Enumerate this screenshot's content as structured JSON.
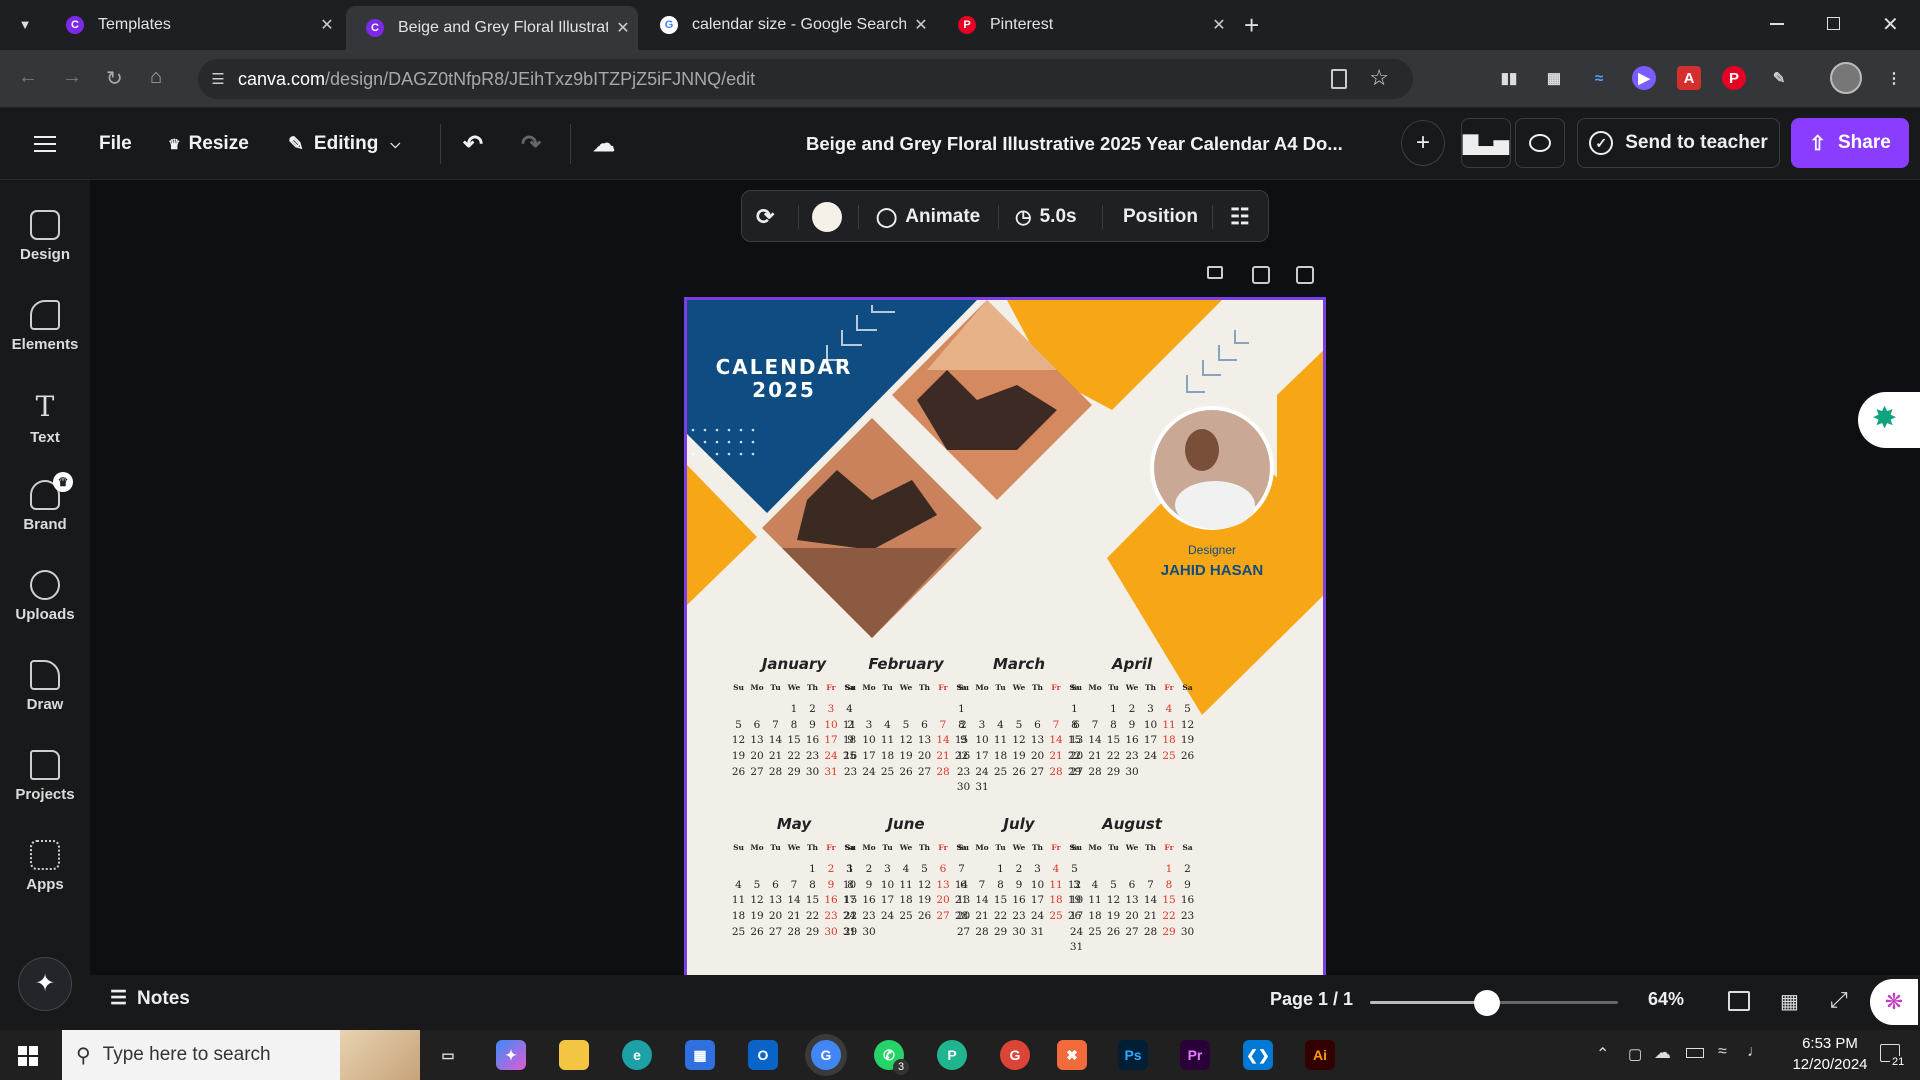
{
  "browser": {
    "tabs": [
      {
        "title": "Templates",
        "icon": "canva-icon",
        "active": false
      },
      {
        "title": "Beige and Grey Floral Illustrativ",
        "icon": "canva-icon",
        "active": true
      },
      {
        "title": "calendar size - Google Search",
        "icon": "google-icon",
        "active": false
      },
      {
        "title": "Pinterest",
        "icon": "pinterest-icon",
        "active": false
      }
    ],
    "new_tab": "+",
    "url_host": "canva.com",
    "url_path": "/design/DAGZ0tNfpR8/JEihTxz9bITZPjZ5iFJNNQ/edit"
  },
  "header": {
    "menu_icon": "hamburger-icon",
    "file": "File",
    "resize": "Resize",
    "editing": "Editing",
    "doc_title": "Beige and Grey Floral Illustrative 2025 Year Calendar A4 Do...",
    "send": "Send to teacher",
    "share": "Share",
    "add": "+"
  },
  "sidebar": {
    "items": [
      {
        "label": "Design",
        "icon": "design-icon"
      },
      {
        "label": "Elements",
        "icon": "elements-icon"
      },
      {
        "label": "Text",
        "icon": "text-icon"
      },
      {
        "label": "Brand",
        "icon": "brand-icon"
      },
      {
        "label": "Uploads",
        "icon": "uploads-icon"
      },
      {
        "label": "Draw",
        "icon": "draw-icon"
      },
      {
        "label": "Projects",
        "icon": "projects-icon"
      },
      {
        "label": "Apps",
        "icon": "apps-icon"
      }
    ],
    "text_glyph": "T"
  },
  "context_toolbar": {
    "animate": "Animate",
    "duration": "5.0s",
    "position": "Position"
  },
  "design": {
    "title_line1": "CALENDAR",
    "title_line2": "2025",
    "designer_label": "Designer",
    "designer_name": "JAHID HASAN",
    "weekday_header": [
      "Su",
      "Mo",
      "Tu",
      "We",
      "Th",
      "Fr",
      "Sa"
    ],
    "months": [
      {
        "name": "January",
        "rows": [
          [
            "",
            "",
            "",
            "1",
            "2",
            "3",
            "4"
          ],
          [
            "5",
            "6",
            "7",
            "8",
            "9",
            "10",
            "11"
          ],
          [
            "12",
            "13",
            "14",
            "15",
            "16",
            "17",
            "18"
          ],
          [
            "19",
            "20",
            "21",
            "22",
            "23",
            "24",
            "25"
          ],
          [
            "26",
            "27",
            "28",
            "29",
            "30",
            "31",
            ""
          ]
        ]
      },
      {
        "name": "February",
        "rows": [
          [
            "",
            "",
            "",
            "",
            "",
            "",
            "1"
          ],
          [
            "2",
            "3",
            "4",
            "5",
            "6",
            "7",
            "8"
          ],
          [
            "16",
            "17",
            "18",
            "19",
            "20",
            "21",
            "22"
          ],
          [
            "23",
            "24",
            "25",
            "26",
            "27",
            "28",
            ""
          ]
        ],
        "extra_rows": [
          [
            "9",
            "10",
            "11",
            "12",
            "13",
            "14",
            "15"
          ]
        ]
      },
      {
        "name": "March",
        "rows": [
          [
            "",
            "",
            "",
            "",
            "",
            "",
            "1"
          ],
          [
            "2",
            "3",
            "4",
            "5",
            "6",
            "7",
            "8"
          ],
          [
            "9",
            "10",
            "11",
            "12",
            "13",
            "14",
            "15"
          ],
          [
            "16",
            "17",
            "18",
            "19",
            "20",
            "21",
            "22"
          ],
          [
            "23",
            "24",
            "25",
            "26",
            "27",
            "28",
            "29"
          ],
          [
            "30",
            "31",
            "",
            "",
            "",
            "",
            ""
          ]
        ]
      },
      {
        "name": "April",
        "rows": [
          [
            "",
            "",
            "1",
            "2",
            "3",
            "4",
            "5"
          ],
          [
            "6",
            "7",
            "8",
            "9",
            "10",
            "11",
            "12"
          ],
          [
            "13",
            "14",
            "15",
            "16",
            "17",
            "18",
            "19"
          ],
          [
            "20",
            "21",
            "22",
            "23",
            "24",
            "25",
            "26"
          ],
          [
            "27",
            "28",
            "29",
            "30",
            "",
            "",
            ""
          ]
        ]
      },
      {
        "name": "May",
        "rows": [
          [
            "",
            "",
            "",
            "",
            "1",
            "2",
            "3"
          ],
          [
            "4",
            "5",
            "6",
            "7",
            "8",
            "9",
            "10"
          ],
          [
            "11",
            "12",
            "13",
            "14",
            "15",
            "16",
            "17"
          ],
          [
            "18",
            "19",
            "20",
            "21",
            "22",
            "23",
            "24"
          ],
          [
            "25",
            "26",
            "27",
            "28",
            "29",
            "30",
            "31"
          ]
        ]
      },
      {
        "name": "June",
        "rows": [
          [
            "1",
            "2",
            "3",
            "4",
            "5",
            "6",
            "7"
          ],
          [
            "8",
            "9",
            "10",
            "11",
            "12",
            "13",
            "14"
          ],
          [
            "15",
            "16",
            "17",
            "18",
            "19",
            "20",
            "21"
          ],
          [
            "22",
            "23",
            "24",
            "25",
            "26",
            "27",
            "28"
          ],
          [
            "29",
            "30",
            "",
            "",
            "",
            "",
            ""
          ]
        ]
      },
      {
        "name": "July",
        "rows": [
          [
            "",
            "",
            "1",
            "2",
            "3",
            "4",
            "5"
          ],
          [
            "6",
            "7",
            "8",
            "9",
            "10",
            "11",
            "12"
          ],
          [
            "13",
            "14",
            "15",
            "16",
            "17",
            "18",
            "19"
          ],
          [
            "20",
            "21",
            "22",
            "23",
            "24",
            "25",
            "26"
          ],
          [
            "27",
            "28",
            "29",
            "30",
            "31",
            "",
            ""
          ]
        ]
      },
      {
        "name": "August",
        "rows": [
          [
            "",
            "",
            "",
            "",
            "",
            "1",
            "2"
          ],
          [
            "3",
            "4",
            "5",
            "6",
            "7",
            "8",
            "9"
          ],
          [
            "10",
            "11",
            "12",
            "13",
            "14",
            "15",
            "16"
          ],
          [
            "17",
            "18",
            "19",
            "20",
            "21",
            "22",
            "23"
          ],
          [
            "24",
            "25",
            "26",
            "27",
            "28",
            "29",
            "30"
          ],
          [
            "31",
            "",
            "",
            "",
            "",
            "",
            ""
          ]
        ]
      }
    ],
    "colors": {
      "navy": "#0f4c81",
      "orange": "#f7a616",
      "cream": "#f2efe8",
      "red": "#e0352b"
    }
  },
  "bottom": {
    "notes": "Notes",
    "page": "Page 1 / 1",
    "zoom": "64%",
    "zoom_level": 0.47
  },
  "taskbar": {
    "search_placeholder": "Type here to search",
    "time": "6:53 PM",
    "date": "12/20/2024",
    "notif_count": "21",
    "whatsapp_badge": "3",
    "ps": "Ps",
    "pr": "Pr",
    "ai": "Ai"
  }
}
